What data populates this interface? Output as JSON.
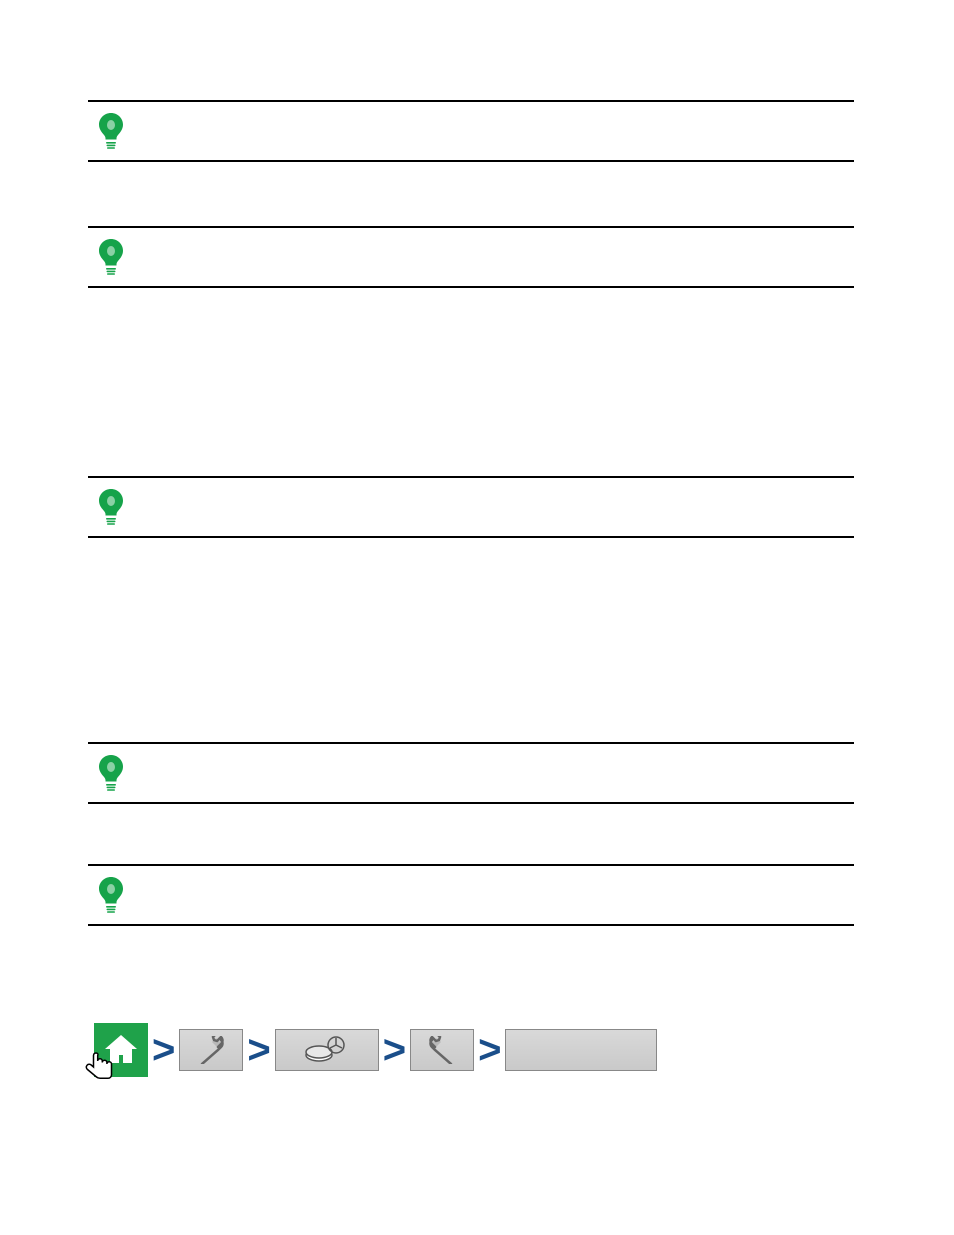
{
  "tips": [
    {
      "icon": "lightbulb-icon"
    },
    {
      "icon": "lightbulb-icon"
    },
    {
      "icon": "lightbulb-icon"
    },
    {
      "icon": "lightbulb-icon"
    },
    {
      "icon": "lightbulb-icon"
    }
  ],
  "nav": {
    "home_icon": "home-icon",
    "pointer_icon": "hand-pointer-icon",
    "wrench_icon": "wrench-icon",
    "disc_icon": "disc-icon",
    "tool_icon": "wrench-icon",
    "last_label": ""
  },
  "colors": {
    "accent_green": "#16a34a",
    "chevron_blue": "#1a4e8a",
    "button_gray": "#c9c9c9"
  }
}
